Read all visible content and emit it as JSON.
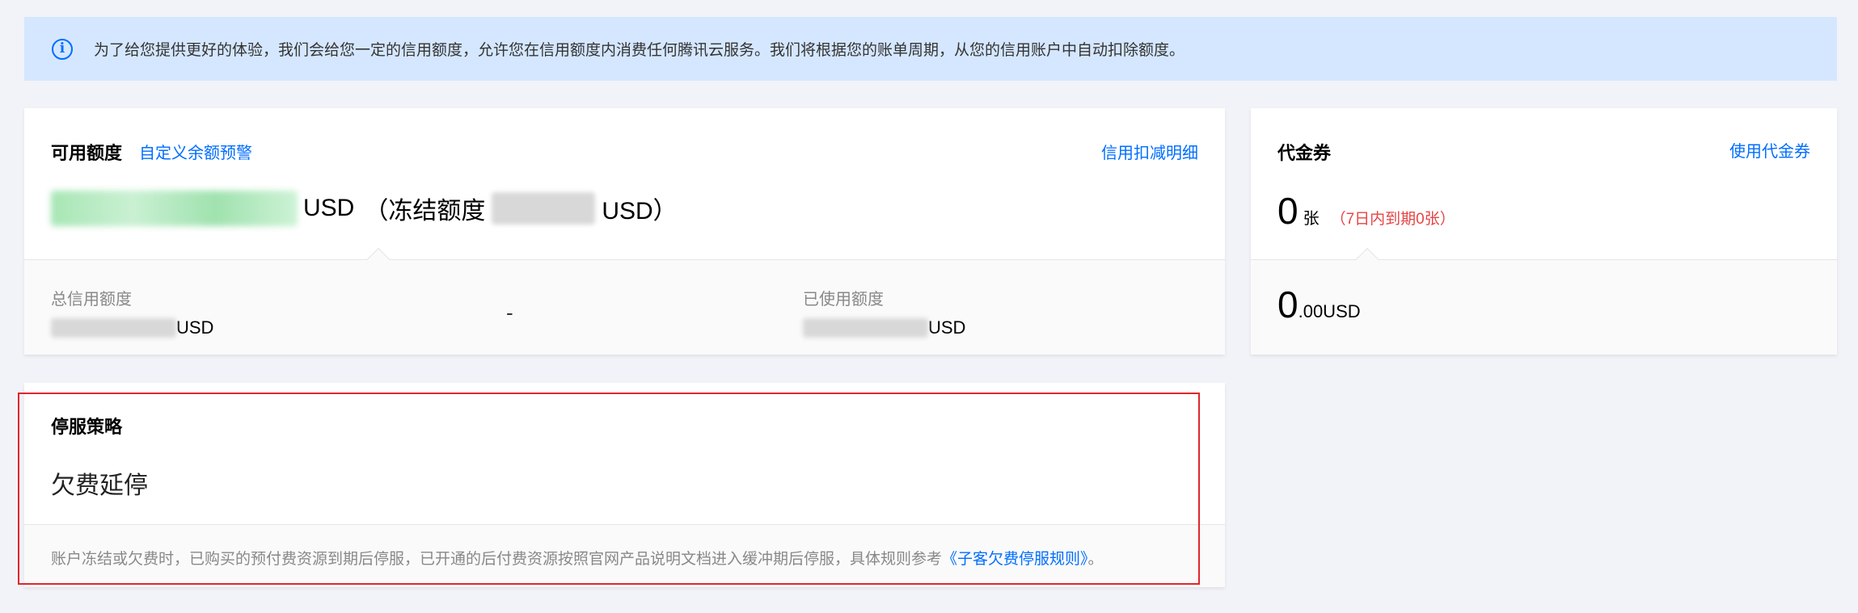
{
  "notice": {
    "icon": "info-icon",
    "text": "为了给您提供更好的体验，我们会给您一定的信用额度，允许您在信用额度内消费任何腾讯云服务。我们将根据您的账单周期，从您的信用账户中自动扣除额度。"
  },
  "credit": {
    "title": "可用额度",
    "custom_alert_link": "自定义余额预警",
    "detail_link": "信用扣减明细",
    "available_currency": "USD",
    "frozen_prefix": "（冻结额度",
    "frozen_currency": "USD）",
    "total_label": "总信用额度",
    "total_currency": "USD",
    "middle_value": "-",
    "used_label": "已使用额度",
    "used_currency": "USD"
  },
  "voucher": {
    "title": "代金券",
    "use_link": "使用代金券",
    "count": "0",
    "count_unit": "张",
    "expire_note": "（7日内到期0张）",
    "amount_int": "0",
    "amount_dec": ".00USD"
  },
  "policy": {
    "title": "停服策略",
    "value": "欠费延停",
    "desc": "账户冻结或欠费时，已购买的预付费资源到期后停服，已开通的后付费资源按照官网产品说明文档进入缓冲期后停服，具体规则参考",
    "rule_link": "《子客欠费停服规则》",
    "desc_end": "。"
  },
  "colors": {
    "accent": "#006eff",
    "notice_bg": "#d5e7ff",
    "warning": "#e54545",
    "highlight_border": "#e0262b"
  }
}
